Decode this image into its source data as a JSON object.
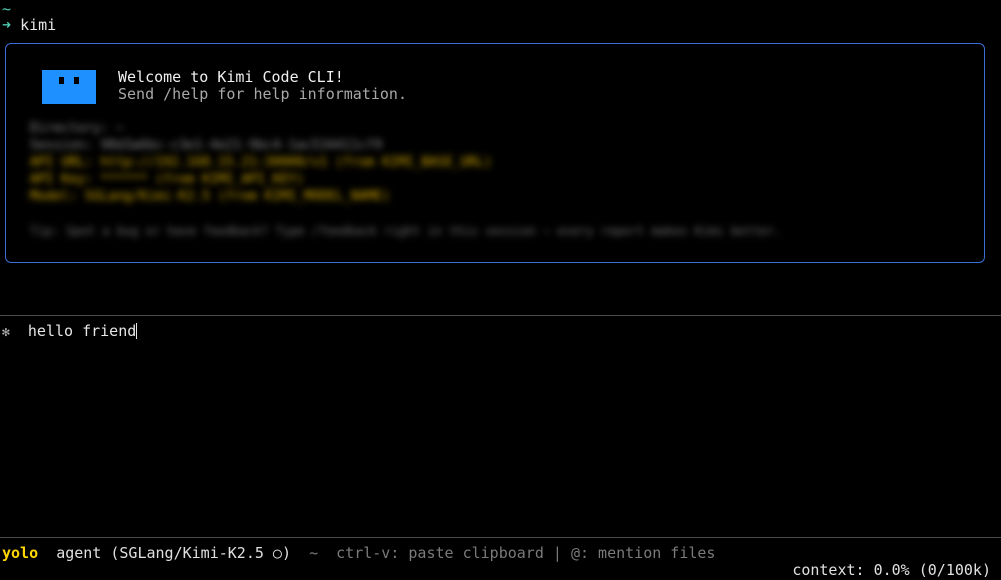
{
  "shell": {
    "cwd": "~",
    "arrow": "➜",
    "command": "kimi"
  },
  "welcome": {
    "title": "Welcome to Kimi Code CLI!",
    "subtitle": "Send /help for help information.",
    "info_lines": [
      {
        "text": "Directory: ~",
        "tone": "gray"
      },
      {
        "text": "Session: 98d3a6bc-c3e1-4e21-9bc4-1ac534411cf9",
        "tone": "gray"
      },
      {
        "text": "API URL: http://192.168.15.21:30000/v1 (from KIMI_BASE_URL)",
        "tone": "yellow"
      },
      {
        "text": "API Key: ****** (from KIMI_API_KEY)",
        "tone": "yellow"
      },
      {
        "text": "Model: SGLang/Kimi-K2.5 (from KIMI_MODEL_NAME)",
        "tone": "yellow"
      },
      {
        "text": "Tip: Spot a bug or have feedback? Type /feedback right in this session — every report makes Kimi better.",
        "tone": "dim"
      }
    ]
  },
  "input": {
    "icon": "sparkle-icon",
    "value": "hello friend"
  },
  "status": {
    "mode": "yolo",
    "agent": "agent (SGLang/Kimi-K2.5 ○)",
    "separator": "~",
    "hints": "ctrl-v: paste clipboard | @: mention files",
    "context": "context: 0.0% (0/100k)"
  },
  "colors": {
    "background": "#000000",
    "box_border": "#3b6fd6",
    "logo": "#1e90ff",
    "accent_green": "#4ec9b0",
    "yolo_yellow": "#ffd700"
  }
}
